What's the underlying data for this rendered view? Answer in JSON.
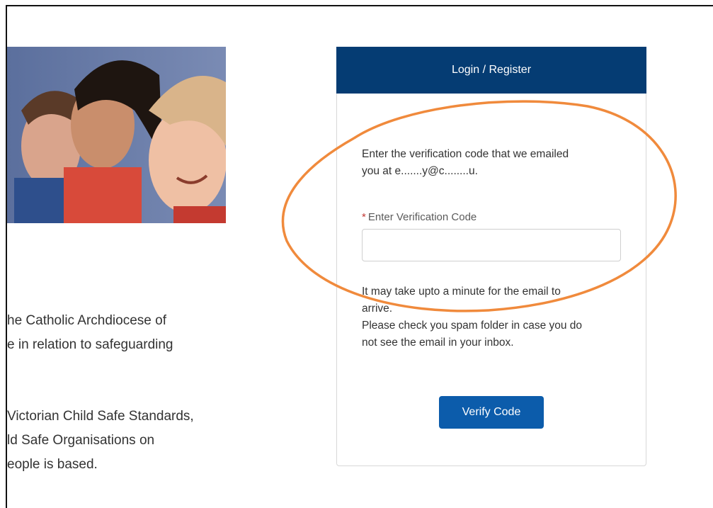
{
  "left_column": {
    "paragraph1": [
      "he Catholic Archdiocese of",
      "e in relation to safeguarding"
    ],
    "paragraph2": [
      "Victorian Child Safe Standards,",
      "ld Safe Organisations on",
      "eople is based."
    ]
  },
  "panel": {
    "title": "Login / Register",
    "instruction_line1": "Enter the verification code that we emailed",
    "instruction_line2": "you at e.......y@c........u.",
    "field_label": "Enter Verification Code",
    "required_marker": "*",
    "code_value": "",
    "note_line1": "It may take upto a minute for the email to",
    "note_line2": "arrive.",
    "spam_line1": "Please check you spam folder in case you do",
    "spam_line2": "not see the email in your inbox.",
    "verify_button": "Verify Code"
  },
  "colors": {
    "header_bg": "#053c73",
    "button_bg": "#0c5cab",
    "annotation": "#f08a3c",
    "required": "#c23934"
  }
}
